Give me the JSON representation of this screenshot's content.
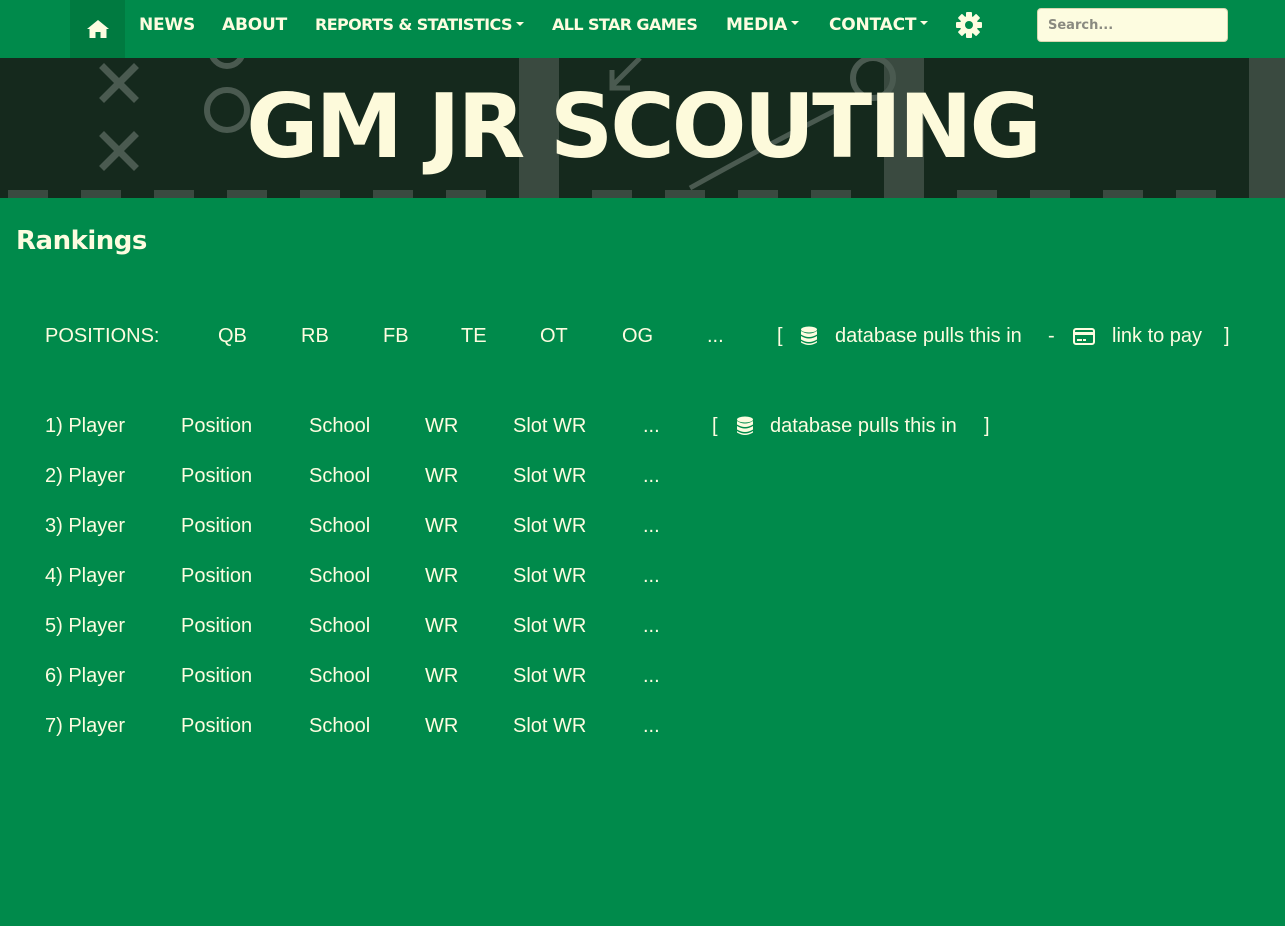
{
  "nav": {
    "items": [
      {
        "label": "NEWS",
        "dropdown": false
      },
      {
        "label": "ABOUT",
        "dropdown": false
      },
      {
        "label": "REPORTS & STATISTICS",
        "dropdown": true
      },
      {
        "label": "ALL STAR GAMES",
        "dropdown": false
      },
      {
        "label": "MEDIA",
        "dropdown": true
      },
      {
        "label": "CONTACT",
        "dropdown": true
      }
    ],
    "search_placeholder": "Search..."
  },
  "hero": {
    "title": "GM JR SCOUTING"
  },
  "rankings": {
    "title": "Rankings",
    "positions_label": "POSITIONS:",
    "positions": [
      "QB",
      "RB",
      "FB",
      "TE",
      "OT",
      "OG",
      "..."
    ],
    "positions_note": {
      "open": "[",
      "db_text": "database pulls this in",
      "separator": "-",
      "pay_text": "link to pay",
      "close": "]"
    },
    "rows": [
      {
        "rank": "1) Player",
        "position": "Position",
        "school": "School",
        "pos1": "WR",
        "pos2": "Slot WR",
        "more": "..."
      },
      {
        "rank": "2) Player",
        "position": "Position",
        "school": "School",
        "pos1": "WR",
        "pos2": "Slot WR",
        "more": "..."
      },
      {
        "rank": "3) Player",
        "position": "Position",
        "school": "School",
        "pos1": "WR",
        "pos2": "Slot WR",
        "more": "..."
      },
      {
        "rank": "4) Player",
        "position": "Position",
        "school": "School",
        "pos1": "WR",
        "pos2": "Slot WR",
        "more": "..."
      },
      {
        "rank": "5) Player",
        "position": "Position",
        "school": "School",
        "pos1": "WR",
        "pos2": "Slot WR",
        "more": "..."
      },
      {
        "rank": "6) Player",
        "position": "Position",
        "school": "School",
        "pos1": "WR",
        "pos2": "Slot WR",
        "more": "..."
      },
      {
        "rank": "7) Player",
        "position": "Position",
        "school": "School",
        "pos1": "WR",
        "pos2": "Slot WR",
        "more": "..."
      }
    ],
    "row_note": {
      "open": "[",
      "db_text": "database pulls this in",
      "close": "]"
    }
  },
  "colors": {
    "brand_green": "#008a4b",
    "hero_dark": "#15291d",
    "text_cream": "#fdfce0"
  },
  "icons": {
    "home": "home-icon",
    "settings": "gear-icon",
    "database": "database-icon",
    "payment": "credit-card-icon"
  }
}
